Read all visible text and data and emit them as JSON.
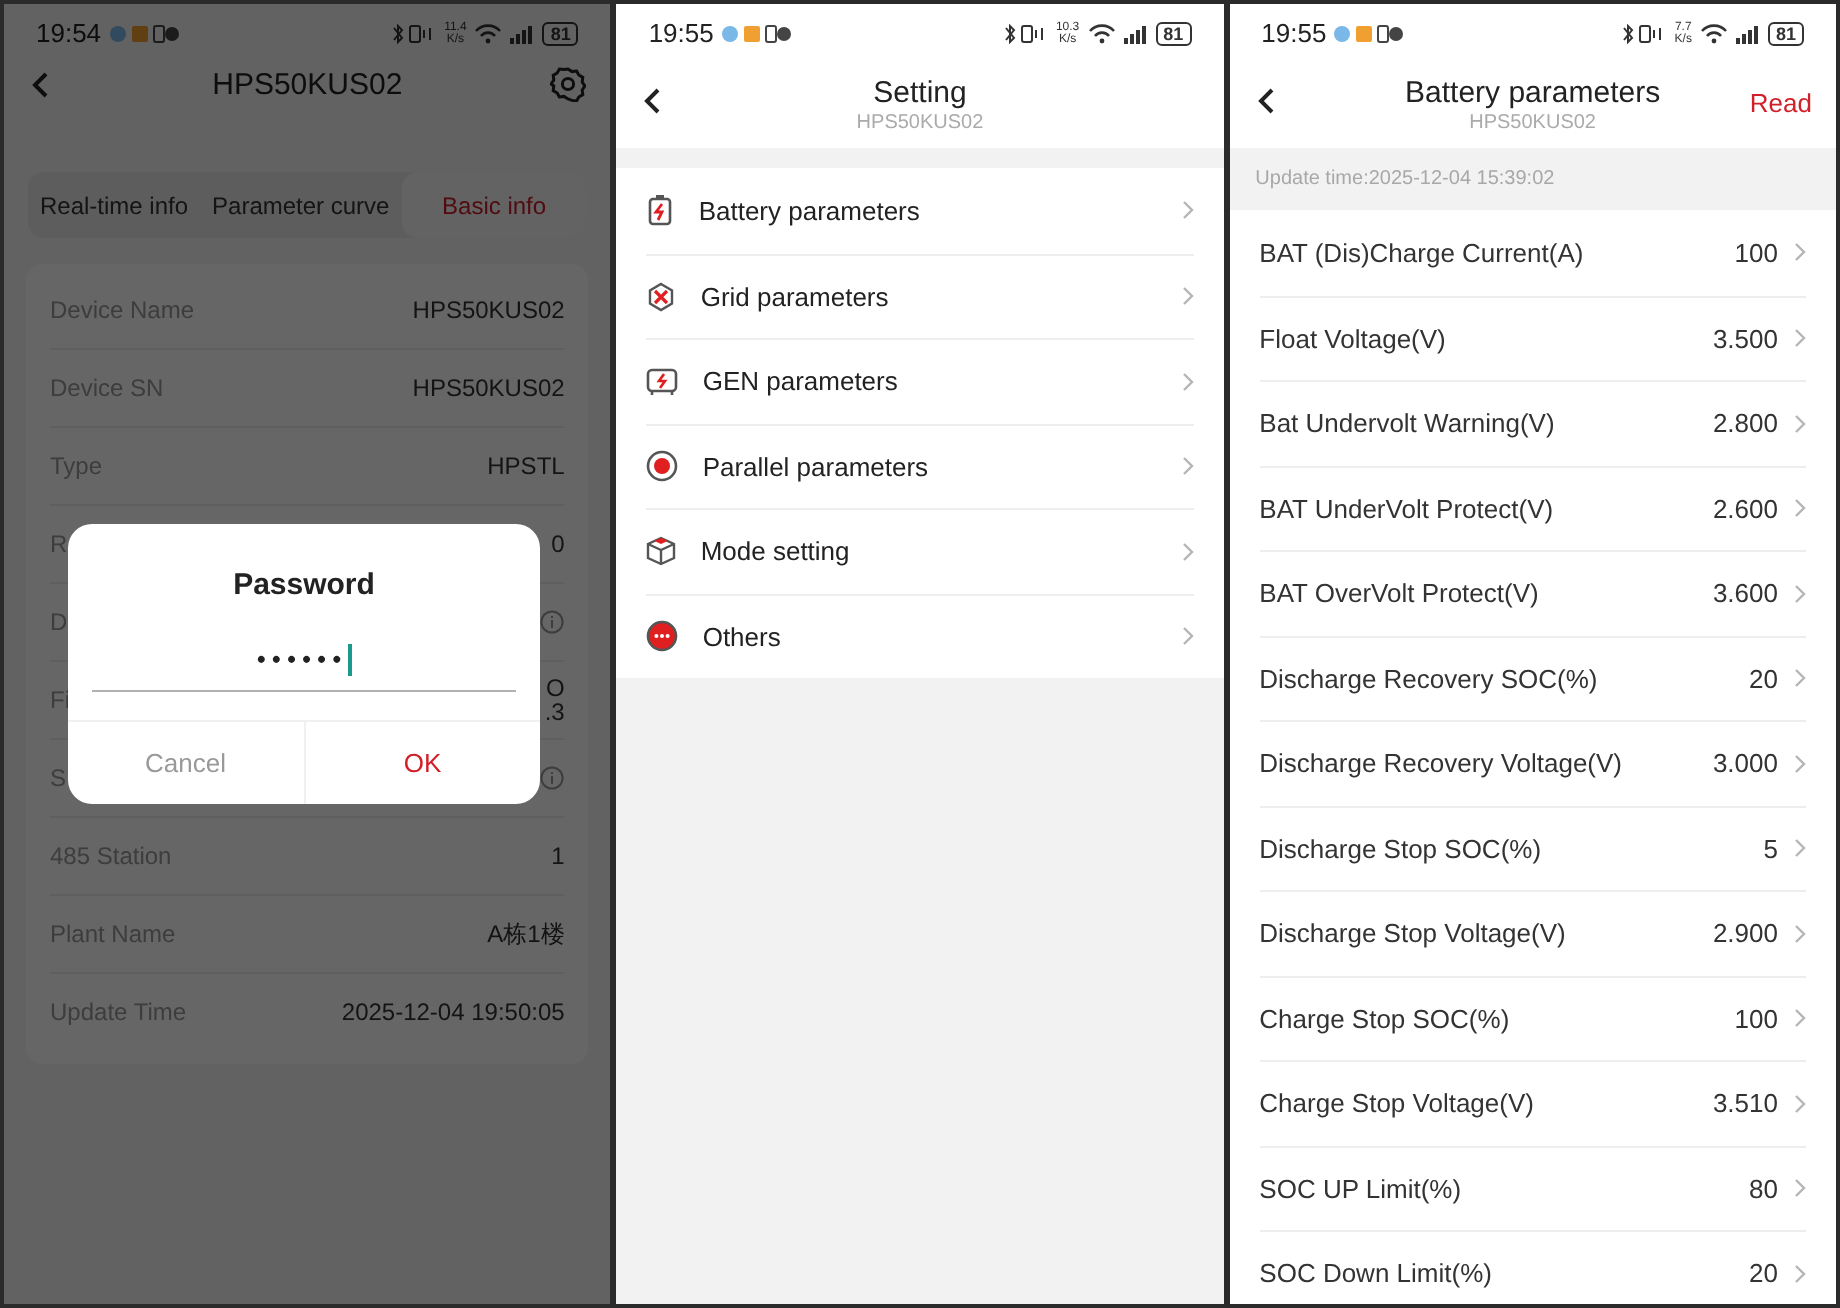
{
  "screens": [
    {
      "kind": "device_info",
      "status_bar": {
        "time": "19:54",
        "net_speed": "11.4",
        "net_unit": "K/s",
        "battery": "81"
      },
      "title": "HPS50KUS02",
      "tabs": [
        {
          "label": "Real-time info",
          "selected": false
        },
        {
          "label": "Parameter curve",
          "selected": false
        },
        {
          "label": "Basic info",
          "selected": true
        }
      ],
      "rows": [
        {
          "kind": "text",
          "label": "Device Name",
          "value": "HPS50KUS02"
        },
        {
          "kind": "text",
          "label": "Device SN",
          "value": "HPS50KUS02"
        },
        {
          "kind": "text",
          "label": "Type",
          "value": "HPSTL"
        },
        {
          "kind": "text",
          "label": "R",
          "value": "0"
        },
        {
          "kind": "info",
          "label": "D"
        },
        {
          "kind": "text",
          "label": "Fi",
          "value": "O\n.3"
        },
        {
          "kind": "info",
          "label": "S"
        },
        {
          "kind": "text",
          "label": "485 Station",
          "value": "1"
        },
        {
          "kind": "text",
          "label": "Plant Name",
          "value": "A栋1楼"
        },
        {
          "kind": "text",
          "label": "Update Time",
          "value": "2025-12-04 19:50:05"
        }
      ],
      "dialog": {
        "title": "Password",
        "value": "••••••",
        "buttons": [
          {
            "kind": "cancel",
            "label": "Cancel"
          },
          {
            "kind": "confirm",
            "label": "OK"
          }
        ]
      }
    },
    {
      "kind": "settings_menu",
      "status_bar": {
        "time": "19:55",
        "net_speed": "10.3",
        "net_unit": "K/s",
        "battery": "81"
      },
      "title": "Setting",
      "subtitle": "HPS50KUS02",
      "items": [
        {
          "kind": "battery",
          "label": "Battery parameters"
        },
        {
          "kind": "grid",
          "label": "Grid parameters"
        },
        {
          "kind": "generator",
          "label": "GEN parameters"
        },
        {
          "kind": "parallel",
          "label": "Parallel parameters"
        },
        {
          "kind": "mode",
          "label": "Mode setting"
        },
        {
          "kind": "others",
          "label": "Others"
        }
      ]
    },
    {
      "kind": "parameter_list",
      "status_bar": {
        "time": "19:55",
        "net_speed": "7.7",
        "net_unit": "K/s",
        "battery": "81"
      },
      "title": "Battery parameters",
      "subtitle": "HPS50KUS02",
      "action": "Read",
      "update_time": "Update time:2025-12-04 15:39:02",
      "rows": [
        {
          "label": "BAT (Dis)Charge Current(A)",
          "value": "100"
        },
        {
          "label": "Float Voltage(V)",
          "value": "3.500"
        },
        {
          "label": "Bat Undervolt Warning(V)",
          "value": "2.800"
        },
        {
          "label": "BAT UnderVolt Protect(V)",
          "value": "2.600"
        },
        {
          "label": "BAT OverVolt Protect(V)",
          "value": "3.600"
        },
        {
          "label": "Discharge Recovery SOC(%)",
          "value": "20"
        },
        {
          "label": "Discharge Recovery Voltage(V)",
          "value": "3.000"
        },
        {
          "label": "Discharge Stop SOC(%)",
          "value": "5"
        },
        {
          "label": "Discharge Stop Voltage(V)",
          "value": "2.900"
        },
        {
          "label": "Charge Stop SOC(%)",
          "value": "100"
        },
        {
          "label": "Charge Stop Voltage(V)",
          "value": "3.510"
        },
        {
          "label": "SOC UP Limit(%)",
          "value": "80"
        },
        {
          "label": "SOC Down Limit(%)",
          "value": "20"
        }
      ]
    }
  ]
}
